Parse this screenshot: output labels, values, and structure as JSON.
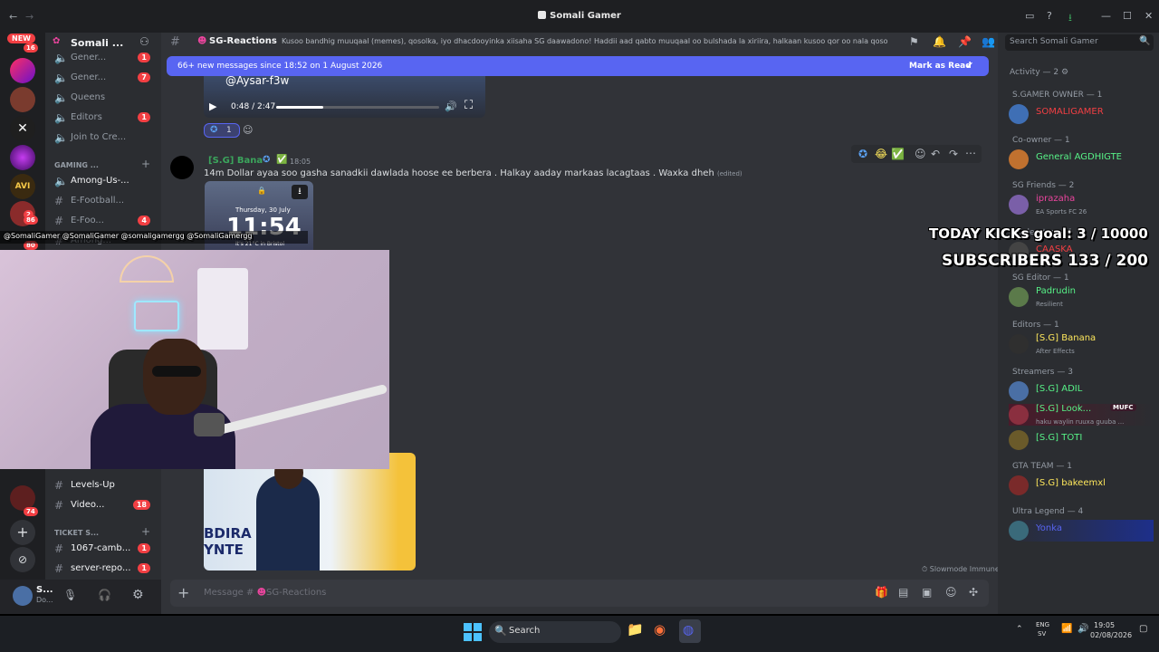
{
  "window": {
    "title": "Somali Gamer",
    "back_icon": "←",
    "forward_icon": "→"
  },
  "guilds": {
    "new_label": "NEW",
    "new_count": "16",
    "badges": [
      "2",
      "86",
      "80",
      "74"
    ]
  },
  "server": {
    "name": "Somali ...",
    "channels_top": [
      {
        "label": "Gener...",
        "badge": "1"
      },
      {
        "label": "Gener...",
        "badge": "7"
      },
      {
        "label": "Queens",
        "badge": ""
      },
      {
        "label": "Editors",
        "badge": "1"
      },
      {
        "label": "Join to Cre...",
        "badge": ""
      }
    ],
    "category_gaming": "GAMING ...",
    "gaming_channels": [
      {
        "label": "Among-Us-...",
        "badge": ""
      },
      {
        "label": "E-Football...",
        "badge": ""
      },
      {
        "label": "E-Foo...",
        "badge": "4"
      },
      {
        "label": "Among...",
        "badge": ""
      }
    ],
    "lower_channels": [
      {
        "label": "Levels-Up",
        "badge": ""
      },
      {
        "label": "Video...",
        "badge": "18"
      }
    ],
    "category_ticket": "TICKET S...",
    "ticket_channels": [
      {
        "label": "1067-camb...",
        "badge": "1"
      },
      {
        "label": "server-repo...",
        "badge": "1"
      }
    ]
  },
  "user_panel": {
    "name": "S...",
    "status": "Do..."
  },
  "channel_header": {
    "name": "SG-Reactions",
    "topic": "Kusoo bandhig muuqaal (memes), qosolka, iyo dhacdooyinka xiisaha SG daawadono! Haddii aad qabto muuqaal oo bulshada la xiriira, halkaan kusoo qor oo nala qosol."
  },
  "banner": {
    "text": "66+ new messages since 18:52 on 1 August 2026",
    "action": "Mark as Read"
  },
  "video_player": {
    "watermark": "@Aysar-f3w",
    "time": "0:48 / 2:47",
    "progress": 0.29
  },
  "reaction_count": "1",
  "message": {
    "author": "[S.G] Bana",
    "time": "18:05",
    "text": "14m Dollar ayaa soo gasha sanadkii dawlada hoose ee berbera . Halkay aaday markaas lacagtaas . Waxka dheh",
    "edited": "(edited)",
    "phone_date": "Thursday, 30 July",
    "phone_time": "11:54",
    "phone_weather": "It's 21°C in Bristol"
  },
  "second_image_text": "BDIRA\nYNTE",
  "slowmode": "Slowmode Immune",
  "composer": {
    "placeholder_prefix": "Message #",
    "channel": "SG-Reactions"
  },
  "overlay": {
    "socials": "@SomaliGamer  @SomaliGamer  @somaligamergg  @SomaliGamergg",
    "goal1": "TODAY KICKs goal: 3 / 10000",
    "goal2": "SUBSCRIBERS 133 / 200"
  },
  "members": {
    "search_placeholder": "Search Somali Gamer",
    "activity": "Activity — 2",
    "groups": [
      {
        "role": "S.GAMER OWNER — 1",
        "members": [
          {
            "name": "SOMALIGAMER",
            "color": "#f23f43",
            "sub": ""
          }
        ]
      },
      {
        "role": "Co-owner — 1",
        "members": [
          {
            "name": "General AGDHIGTE",
            "color": "#57f287",
            "sub": ""
          }
        ]
      },
      {
        "role": "SG Friends — 2",
        "members": [
          {
            "name": "iprazaha",
            "color": "#eb459e",
            "sub": "EA Sports FC 26"
          }
        ]
      },
      {
        "role": "Moderator — 1",
        "members": [
          {
            "name": "CAASKA",
            "color": "#f23f43",
            "sub": ""
          }
        ]
      },
      {
        "role": "SG Editor — 1",
        "members": [
          {
            "name": "Padrudin",
            "color": "#57f287",
            "sub": "Resilient"
          }
        ]
      },
      {
        "role": "Editors — 1",
        "members": [
          {
            "name": "[S.G] Banana",
            "color": "#fee75c",
            "sub": "After Effects"
          }
        ]
      },
      {
        "role": "Streamers — 3",
        "members": [
          {
            "name": "[S.G] ADIL",
            "color": "#57f287",
            "sub": ""
          },
          {
            "name": "[S.G] Look...",
            "color": "#57f287",
            "sub": "haku waylin ruuxa guuba ..."
          },
          {
            "name": "[S.G] TOTI",
            "color": "#57f287",
            "sub": ""
          }
        ]
      },
      {
        "role": "GTA TEAM — 1",
        "members": [
          {
            "name": "[S.G] bakeemxl",
            "color": "#fee75c",
            "sub": ""
          }
        ]
      },
      {
        "role": "Ultra Legend — 4",
        "members": [
          {
            "name": "Yonka",
            "color": "#5865f2",
            "sub": ""
          }
        ]
      }
    ],
    "mufc_tag": "MUFC"
  },
  "taskbar": {
    "search": "Search",
    "lang": "ENG",
    "lang2": "SV",
    "time": "19:05",
    "date": "02/08/2026"
  }
}
